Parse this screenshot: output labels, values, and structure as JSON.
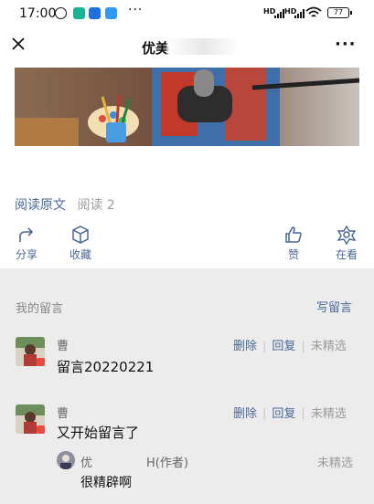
{
  "status_bar": {
    "time": "17:00",
    "more": "···",
    "signal1": "HD",
    "signal2": "HD",
    "battery": "77"
  },
  "nav": {
    "title": "优美",
    "more": "···"
  },
  "article": {
    "read_original": "阅读原文",
    "read_count": "阅读 2",
    "actions": {
      "share": "分享",
      "collect": "收藏",
      "like": "赞",
      "looking": "在看"
    }
  },
  "comments": {
    "header": "我的留言",
    "write": "写留言",
    "items": [
      {
        "name": "曹",
        "text": "留言20220221",
        "delete": "删除",
        "reply": "回复",
        "status": "未精选"
      },
      {
        "name": "曹",
        "text": "又开始留言了",
        "delete": "删除",
        "reply": "回复",
        "status": "未精选",
        "author_reply": {
          "name": "优",
          "author_tag": "H(作者)",
          "text": "很精辟啊",
          "status": "未精选"
        }
      }
    ]
  },
  "colors": {
    "link_blue": "#4a6796",
    "muted": "#9b9b9b",
    "background": "#ececec"
  }
}
